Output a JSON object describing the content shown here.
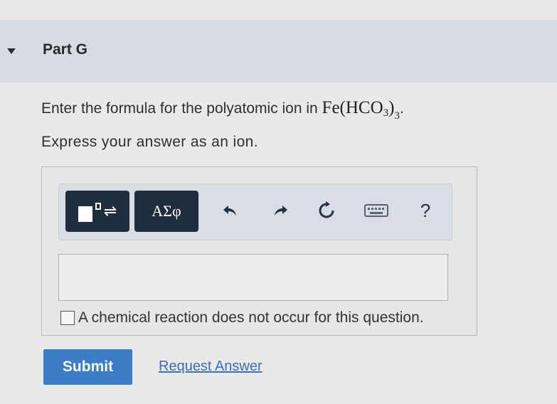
{
  "part": {
    "title": "Part G"
  },
  "question": {
    "prompt_prefix": "Enter the formula for the polyatomic ion in",
    "formula_base": "Fe(HCO",
    "formula_sub_inner": "3",
    "formula_close": ")",
    "formula_sub_outer": "3",
    "formula_period": ".",
    "instruction": "Express your answer as an ion."
  },
  "toolbar": {
    "templates_icon": "templates-icon",
    "symbols_label": "ΑΣφ",
    "undo_icon": "undo-icon",
    "redo_icon": "redo-icon",
    "reset_icon": "reset-icon",
    "keyboard_icon": "keyboard-icon",
    "help_label": "?"
  },
  "answer": {
    "value": ""
  },
  "no_reaction": {
    "label": "A chemical reaction does not occur for this question.",
    "checked": false
  },
  "actions": {
    "submit_label": "Submit",
    "request_label": "Request Answer"
  },
  "colors": {
    "header_bg": "#d7dbe4",
    "toolbar_button": "#1f2d3f",
    "submit": "#3a7cc6",
    "link": "#3c6fb5"
  }
}
